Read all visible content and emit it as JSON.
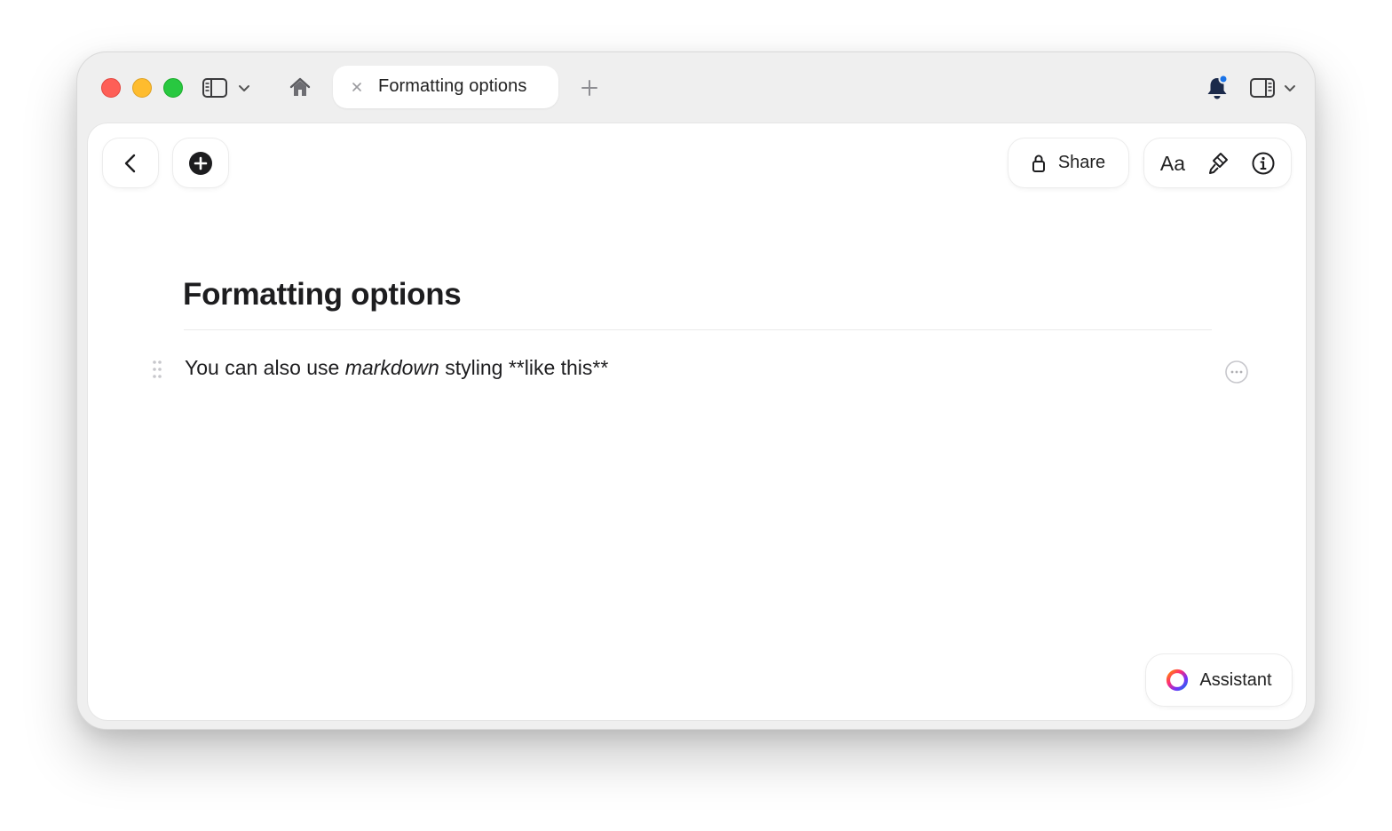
{
  "tab": {
    "title": "Formatting options"
  },
  "toolbar": {
    "share_label": "Share",
    "font_label": "Aa"
  },
  "document": {
    "title": "Formatting options",
    "paragraph": {
      "before": "You can also use ",
      "italic": "markdown",
      "after": " styling **like this**"
    }
  },
  "assistant": {
    "label": "Assistant"
  },
  "icons": {
    "titlebar": [
      "sidebar-toggle-icon",
      "chevron-down-icon",
      "home-icon",
      "close-icon",
      "plus-icon",
      "bell-icon",
      "panel-toggle-icon",
      "chevron-down-icon"
    ],
    "toolbar": [
      "chevron-left-icon",
      "plus-circle-icon",
      "lock-icon",
      "brush-icon",
      "info-icon"
    ],
    "document": [
      "drag-handle-icon",
      "more-icon",
      "assistant-ring-icon"
    ]
  },
  "colors": {
    "close": "#fe5f57",
    "minimize": "#febc2e",
    "maximize": "#28c840",
    "notification_dot": "#1a73e8"
  }
}
